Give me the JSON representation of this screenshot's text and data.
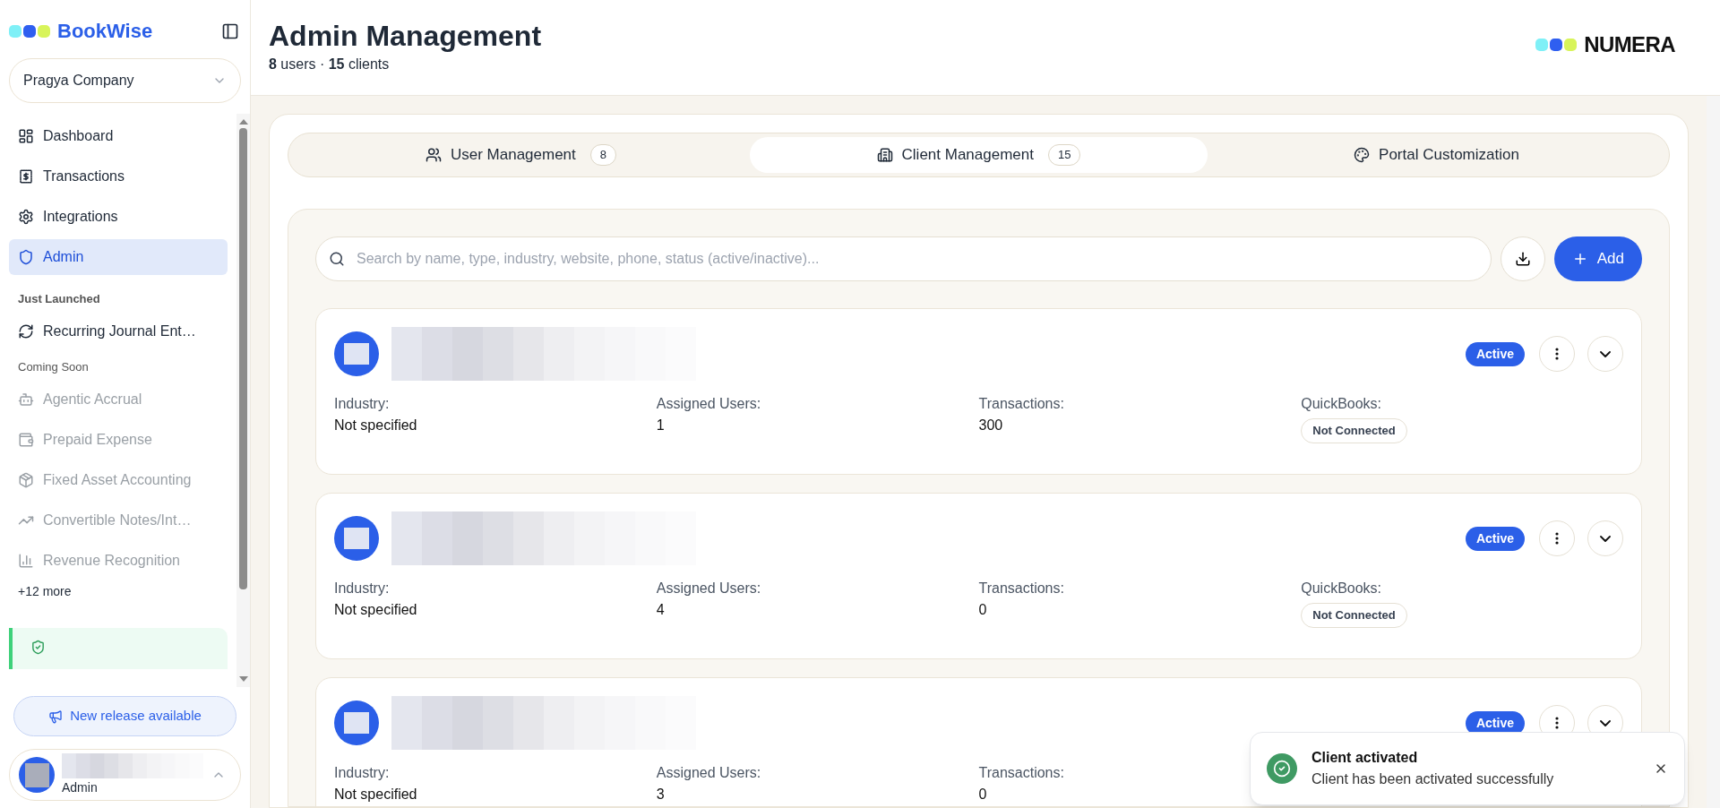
{
  "sidebar": {
    "brand": "BookWise",
    "company": "Pragya Company",
    "nav": [
      {
        "label": "Dashboard",
        "selected": false
      },
      {
        "label": "Transactions",
        "selected": false
      },
      {
        "label": "Integrations",
        "selected": false
      },
      {
        "label": "Admin",
        "selected": true
      }
    ],
    "just_launched": {
      "title": "Just Launched",
      "items": [
        {
          "label": "Recurring Journal Ent…"
        }
      ]
    },
    "coming_soon": {
      "title": "Coming Soon",
      "items": [
        {
          "label": "Agentic Accrual",
          "disabled": true
        },
        {
          "label": "Prepaid Expense",
          "disabled": true
        },
        {
          "label": "Fixed Asset Accounting",
          "disabled": true
        },
        {
          "label": "Convertible Notes/Int…",
          "disabled": true
        },
        {
          "label": "Revenue Recognition",
          "disabled": true
        }
      ],
      "more": "+12 more"
    },
    "release_button": "New release available",
    "user": {
      "role": "Admin"
    }
  },
  "header": {
    "title": "Admin Management",
    "subtitle": "**8** users · **15** clients",
    "logo": "NUMERA"
  },
  "tabs": [
    {
      "label": "User Management",
      "count": "8",
      "selected": false
    },
    {
      "label": "Client Management",
      "count": "15",
      "selected": true
    },
    {
      "label": "Portal Customization",
      "selected": false
    }
  ],
  "search": {
    "placeholder": "Search by name, type, industry, website, phone, status (active/inactive)..."
  },
  "add_button": "Add",
  "clients": [
    {
      "status": "Active",
      "active": true,
      "fields": [
        {
          "label": "Industry:",
          "value": "Not specified"
        },
        {
          "label": "Assigned Users:",
          "value": "1"
        },
        {
          "label": "Transactions:",
          "value": "300"
        },
        {
          "label": "QuickBooks:",
          "value": "Not Connected",
          "kind": "badge"
        }
      ]
    },
    {
      "status": "Active",
      "active": true,
      "fields": [
        {
          "label": "Industry:",
          "value": "Not specified"
        },
        {
          "label": "Assigned Users:",
          "value": "4"
        },
        {
          "label": "Transactions:",
          "value": "0"
        },
        {
          "label": "QuickBooks:",
          "value": "Not Connected",
          "kind": "badge"
        }
      ]
    },
    {
      "status": "Active",
      "active": true,
      "fields": [
        {
          "label": "Industry:",
          "value": "Not specified"
        },
        {
          "label": "Assigned Users:",
          "value": "3"
        },
        {
          "label": "Transactions:",
          "value": "0"
        }
      ]
    }
  ],
  "toast": {
    "title": "Client activated",
    "message": "Client has been activated successfully"
  }
}
